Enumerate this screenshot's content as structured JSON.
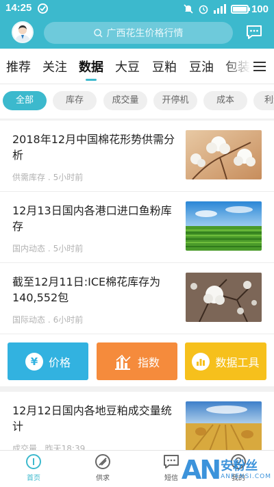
{
  "status_bar": {
    "time": "14:25",
    "battery": "100",
    "battery_level": 1.0
  },
  "header": {
    "search_placeholder": "广西花生价格行情"
  },
  "tabs": {
    "items": [
      "推荐",
      "关注",
      "数据",
      "大豆",
      "豆粕",
      "豆油",
      "包装"
    ],
    "active": "数据"
  },
  "chips": {
    "items": [
      "全部",
      "库存",
      "成交量",
      "开停机",
      "成本",
      "利润"
    ],
    "active": "全部"
  },
  "news": [
    {
      "title": "2018年12月中国棉花形势供需分析",
      "category": "供需库存",
      "time": "5小时前",
      "image": "cotton-branch-photo"
    },
    {
      "title": "12月13日国内各港口进口鱼粉库存",
      "category": "国内动态",
      "time": "5小时前",
      "image": "green-field-photo"
    },
    {
      "title": "截至12月11日:ICE棉花库存为140,552包",
      "category": "国际动态",
      "time": "6小时前",
      "image": "cotton-plant-photo"
    }
  ],
  "tools": [
    {
      "label": "价格",
      "icon": "yuan-icon",
      "color": "#32b2e0"
    },
    {
      "label": "指数",
      "icon": "bar-chart-icon",
      "color": "#f58b3c"
    },
    {
      "label": "数据工具",
      "icon": "data-tool-icon",
      "color": "#f6c01c"
    }
  ],
  "news_after_tools": [
    {
      "title": "12月12日国内各地豆粕成交量统计",
      "category": "成交量",
      "time": "昨天18:39",
      "image": "wheat-field-photo"
    }
  ],
  "bottom_nav": [
    {
      "label": "首页",
      "icon": "home-icon",
      "active": true
    },
    {
      "label": "供求",
      "icon": "supply-icon",
      "active": false
    },
    {
      "label": "短信",
      "icon": "message-icon",
      "active": false
    },
    {
      "label": "我的",
      "icon": "profile-icon",
      "active": false
    }
  ],
  "watermark": {
    "mark": "AN",
    "cn": "安粉丝",
    "en": "ANFENSI.COM"
  },
  "colors": {
    "accent": "#3cb9cd",
    "price": "#32b2e0",
    "index": "#f58b3c",
    "data": "#f6c01c"
  }
}
